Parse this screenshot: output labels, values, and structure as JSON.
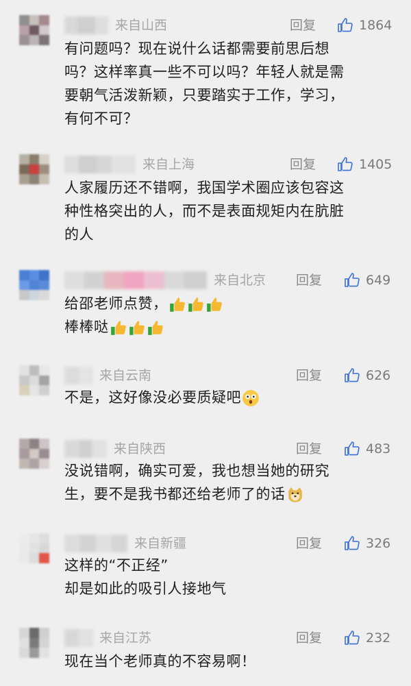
{
  "colors": {
    "background": "#efefef",
    "text": "#1f1f1f",
    "meta": "#a6a6a6",
    "action": "#8a8a8a"
  },
  "comments": [
    {
      "location": "来自山西",
      "reply_label": "回复",
      "likes": "1864",
      "lines": [
        "有问题吗？现在说什么话都需要前思后想",
        "吗？这样率真一些不可以吗？年轻人就是需",
        "要朝气活泼新颖，只要踏实于工作，学习，",
        "有何不可？"
      ]
    },
    {
      "location": "来自上海",
      "reply_label": "回复",
      "likes": "1405",
      "lines": [
        "人家履历还不错啊，我国学术圈应该包容这",
        "种性格突出的人，而不是表面规矩内在肮脏",
        "的人"
      ]
    },
    {
      "location": "来自北京",
      "reply_label": "回复",
      "likes": "649",
      "lines": [
        "给邵老师点赞，",
        "棒棒哒"
      ]
    },
    {
      "location": "来自云南",
      "reply_label": "回复",
      "likes": "626",
      "lines": [
        "不是，这好像没必要质疑吧"
      ]
    },
    {
      "location": "来自陕西",
      "reply_label": "回复",
      "likes": "483",
      "lines": [
        "没说错啊，确实可爱，我也想当她的研究",
        "生，要不是我书都还给老师了的话"
      ]
    },
    {
      "location": "来自新疆",
      "reply_label": "回复",
      "likes": "326",
      "lines": [
        "这样的“不正经”",
        "却是如此的吸引人接地气"
      ]
    },
    {
      "location": "来自江苏",
      "reply_label": "回复",
      "likes": "232",
      "lines": [
        "现在当个老师真的不容易啊！"
      ]
    }
  ]
}
